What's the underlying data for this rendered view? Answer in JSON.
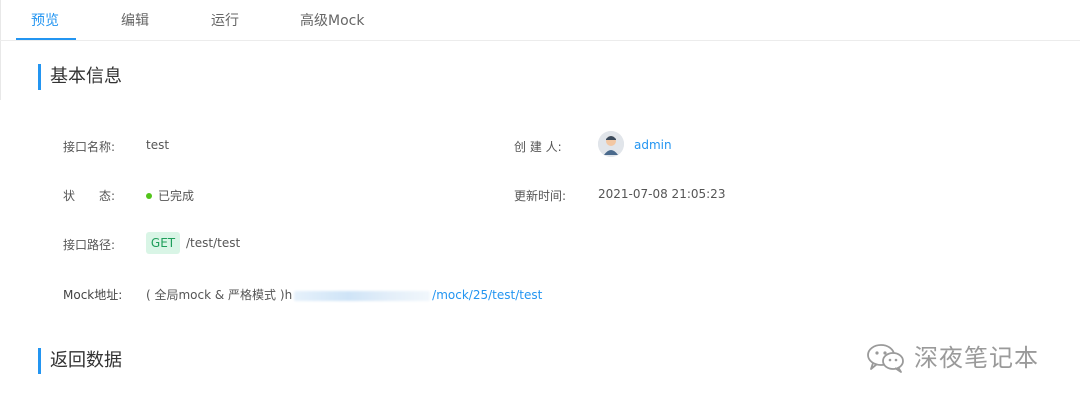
{
  "tabs": [
    {
      "label": "预览",
      "active": true
    },
    {
      "label": "编辑",
      "active": false
    },
    {
      "label": "运行",
      "active": false
    },
    {
      "label": "高级Mock",
      "active": false
    }
  ],
  "basic_info": {
    "title": "基本信息",
    "api_name_label": "接口名称:",
    "api_name": "test",
    "creator_label": "创 建 人:",
    "creator": "admin",
    "status_label": "状　　态:",
    "status": "已完成",
    "status_color": "#52c41a",
    "updated_label": "更新时间:",
    "updated_time": "2021-07-08 21:05:23",
    "path_label": "接口路径:",
    "method": "GET",
    "path": "/test/test",
    "mock_label": "Mock地址:",
    "mock_mode": "( 全局mock & 严格模式 )",
    "mock_url_prefix": "h",
    "mock_url_suffix": "/mock/25/test/test"
  },
  "return_data": {
    "title": "返回数据"
  },
  "watermark": {
    "text": "深夜笔记本",
    "icon": "wechat-icon"
  },
  "colors": {
    "accent": "#2395f1",
    "get_badge_bg": "#d9f5e6",
    "get_badge_text": "#1e9e5a"
  }
}
